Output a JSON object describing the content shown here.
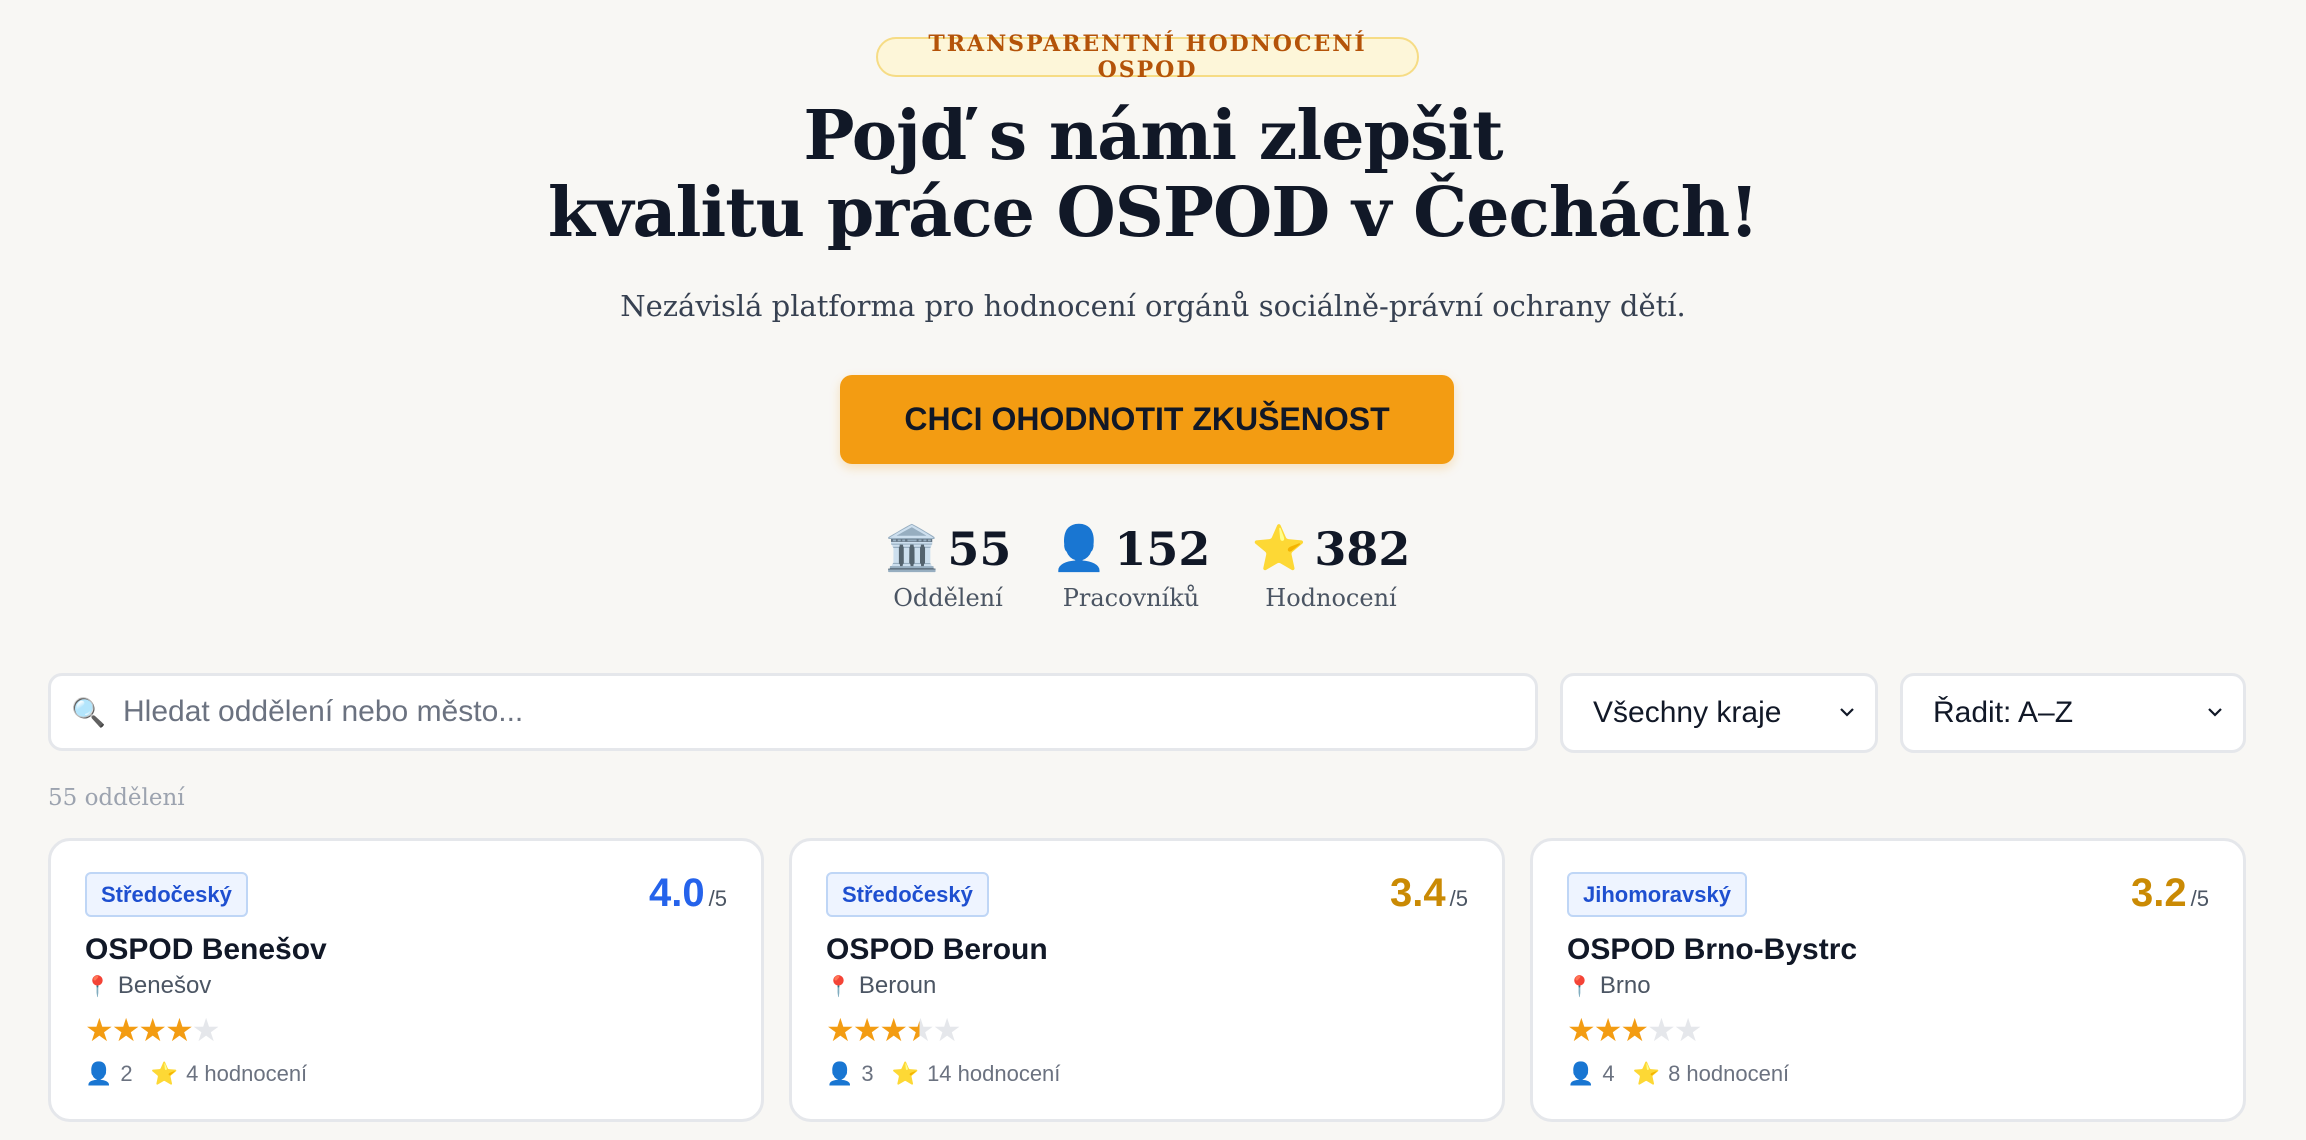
{
  "hero": {
    "badge": "TRANSPARENTNÍ HODNOCENÍ OSPOD",
    "title_line1": "Pojď s námi zlepšit",
    "title_line2": "kvalitu práce OSPOD v Čechách!",
    "subtitle": "Nezávislá platforma pro hodnocení orgánů sociálně-právní ochrany dětí.",
    "cta_label": "CHCI OHODNOTIT ZKUŠENOST"
  },
  "stats": [
    {
      "icon": "🏛️",
      "value": "55",
      "label": "Oddělení"
    },
    {
      "icon": "👤",
      "value": "152",
      "label": "Pracovníků"
    },
    {
      "icon": "⭐",
      "value": "382",
      "label": "Hodnocení"
    }
  ],
  "filters": {
    "search_placeholder": "Hledat oddělení nebo město...",
    "search_value": "",
    "region_selected": "Všechny kraje",
    "sort_selected": "Řadit: A–Z"
  },
  "result_count": "55 oddělení",
  "colors": {
    "accent": "#f39c12",
    "score_high": "#2563eb",
    "score_mid": "#ca8a04"
  },
  "cards": [
    {
      "region": "Středočeský",
      "score": "4.0",
      "score_suffix": "/5",
      "score_color": "#2563eb",
      "name": "OSPOD Benešov",
      "city": "Benešov",
      "rating": 4.0,
      "workers": "2",
      "reviews": "4 hodnocení"
    },
    {
      "region": "Středočeský",
      "score": "3.4",
      "score_suffix": "/5",
      "score_color": "#ca8a04",
      "name": "OSPOD Beroun",
      "city": "Beroun",
      "rating": 3.4,
      "workers": "3",
      "reviews": "14 hodnocení"
    },
    {
      "region": "Jihomoravský",
      "score": "3.2",
      "score_suffix": "/5",
      "score_color": "#ca8a04",
      "name": "OSPOD Brno-Bystrc",
      "city": "Brno",
      "rating": 3.2,
      "workers": "4",
      "reviews": "8 hodnocení"
    }
  ]
}
